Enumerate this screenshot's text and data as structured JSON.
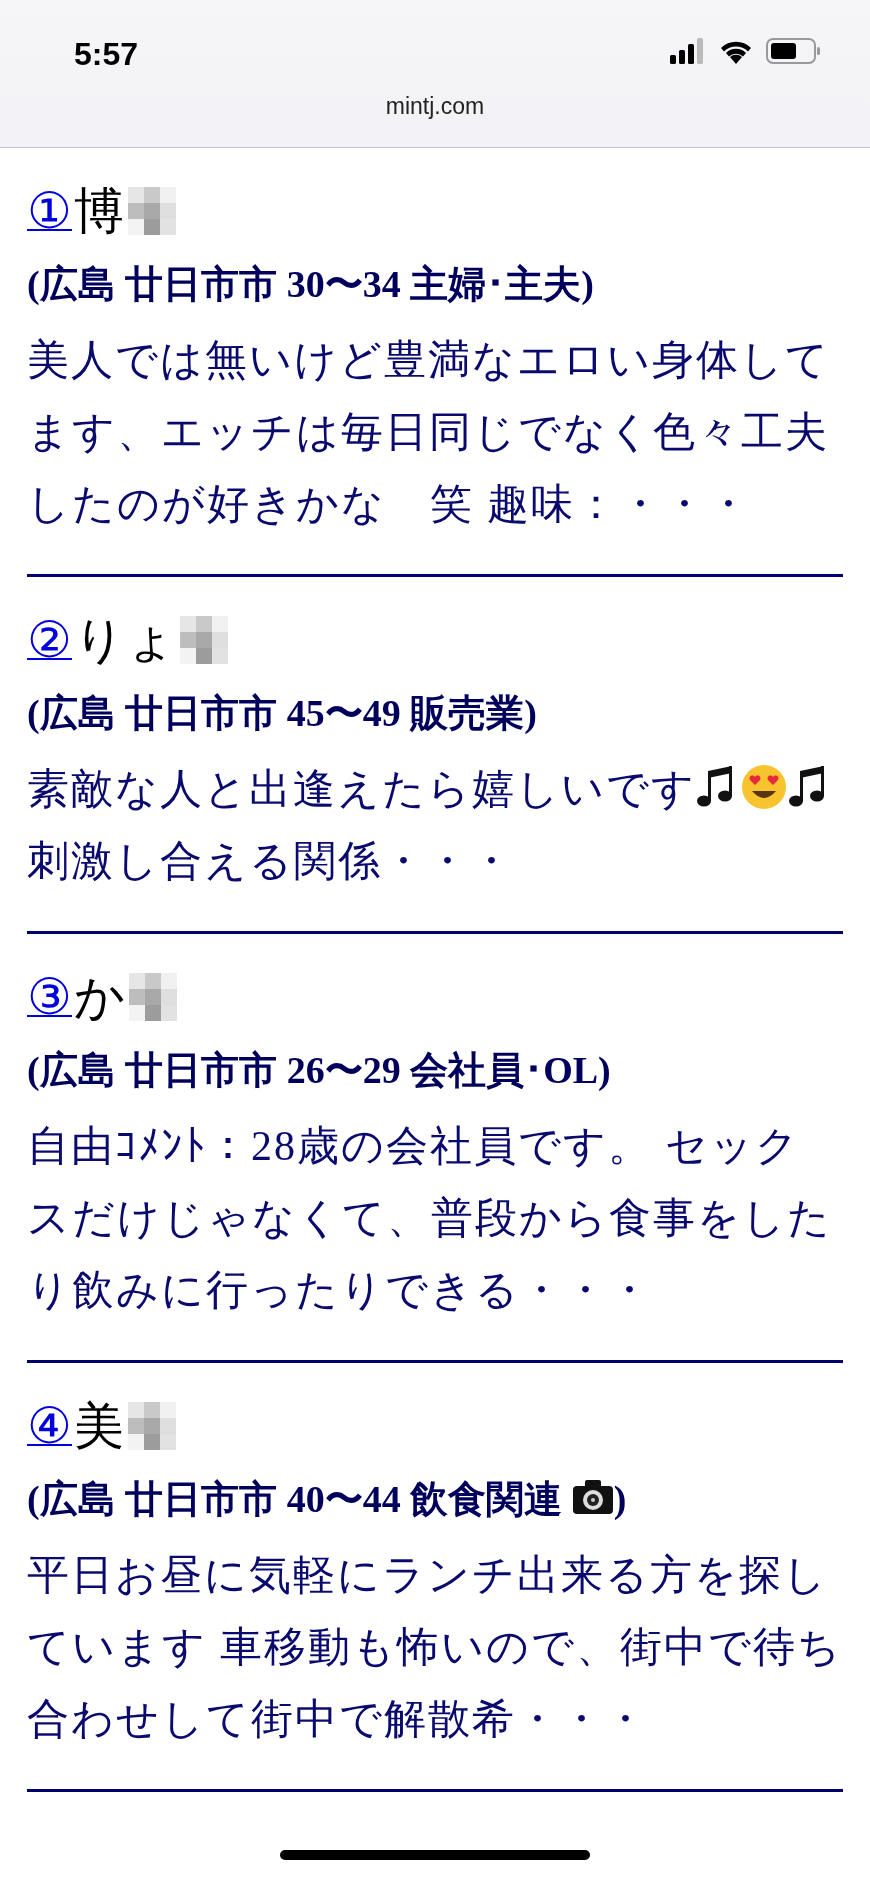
{
  "status_bar": {
    "time": "5:57"
  },
  "address_bar": {
    "url": "mintj.com"
  },
  "profiles": [
    {
      "number": "①",
      "name": "博",
      "meta": [
        {
          "kind": "text",
          "text": "(広島 廿日市市 30〜34 主婦･主夫)"
        }
      ],
      "description": [
        {
          "kind": "text",
          "text": "美人では無いけど豊満なエロい身体してます、エッチは毎日同じでなく色々工夫したのが好きかな　笑 趣味：・・・"
        }
      ]
    },
    {
      "number": "②",
      "name": "りょ",
      "meta": [
        {
          "kind": "text",
          "text": "(広島 廿日市市 45〜49 販売業)"
        }
      ],
      "description": [
        {
          "kind": "text",
          "text": "素敵な人と出逢えたら嬉しいです"
        },
        {
          "kind": "note"
        },
        {
          "kind": "smiley"
        },
        {
          "kind": "note"
        },
        {
          "kind": "text",
          "text": "刺激し合える関係・・・"
        }
      ]
    },
    {
      "number": "③",
      "name": "か",
      "meta": [
        {
          "kind": "text",
          "text": "(広島 廿日市市 26〜29 会社員･OL)"
        }
      ],
      "description": [
        {
          "kind": "text",
          "text": "自由ｺﾒﾝﾄ：28歳の会社員です。 セックスだけじゃなくて、普段から食事をしたり飲みに行ったりできる・・・"
        }
      ]
    },
    {
      "number": "④",
      "name": "美",
      "meta": [
        {
          "kind": "text",
          "text": "(広島 廿日市市 40〜44 飲食関連 "
        },
        {
          "kind": "camera"
        },
        {
          "kind": "text",
          "text": ")"
        }
      ],
      "description": [
        {
          "kind": "text",
          "text": "平日お昼に気軽にランチ出来る方を探しています 車移動も怖いので、街中で待ち合わせして街中で解散希・・・"
        }
      ]
    }
  ]
}
